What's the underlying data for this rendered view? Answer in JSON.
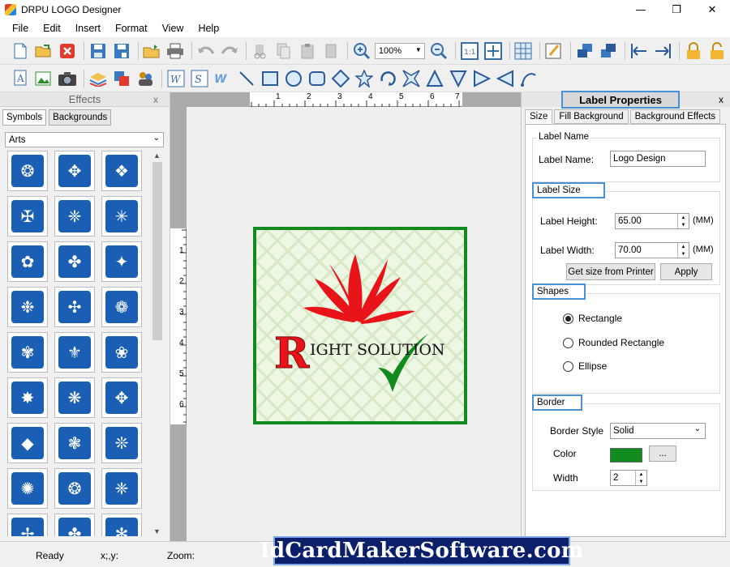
{
  "window": {
    "title": "DRPU LOGO Designer",
    "controls": [
      "—",
      "❐",
      "✕"
    ]
  },
  "menu": [
    "File",
    "Edit",
    "Insert",
    "Format",
    "View",
    "Help"
  ],
  "toolbar": {
    "zoom_value": "100%"
  },
  "effects_panel": {
    "title": "Effects",
    "close": "x",
    "tabs": [
      "Symbols",
      "Backgrounds"
    ],
    "category": "Arts",
    "symbol_glyphs": [
      "❂",
      "✥",
      "❖",
      "✠",
      "❈",
      "✳",
      "✿",
      "✤",
      "✦",
      "❉",
      "✣",
      "❁",
      "✾",
      "⚜",
      "❀",
      "✸",
      "❋",
      "✥",
      "◆",
      "❃",
      "❊",
      "✺",
      "❂",
      "❈",
      "✢",
      "✤",
      "✻"
    ]
  },
  "canvas": {
    "ruler_h": [
      "1",
      "2",
      "3",
      "4",
      "5",
      "6",
      "7"
    ],
    "ruler_v": [
      "1",
      "2",
      "3",
      "4",
      "5",
      "6"
    ],
    "logo": {
      "initial": "R",
      "text": "IGHT SOLUTION",
      "accent_red": "#e8141a",
      "accent_green": "#118a1e"
    }
  },
  "properties": {
    "title": "Label Properties",
    "close": "x",
    "tabs": [
      "Size",
      "Fill Background",
      "Background Effects"
    ],
    "label_name_group": "Label Name",
    "label_name_label": "Label Name:",
    "label_name_value": "Logo Design",
    "label_size_group": "Label Size",
    "height_label": "Label Height:",
    "height_value": "65.00",
    "height_unit": "(MM)",
    "width_label": "Label Width:",
    "width_value": "70.00",
    "width_unit": "(MM)",
    "get_size_button": "Get size from Printer",
    "apply_button": "Apply",
    "shapes_group": "Shapes",
    "shape_options": [
      "Rectangle",
      "Rounded Rectangle",
      "Ellipse"
    ],
    "selected_shape": "Rectangle",
    "border_group": "Border",
    "border_style_label": "Border Style",
    "border_style_value": "Solid",
    "color_label": "Color",
    "color_value": "#118a1e",
    "color_button": "...",
    "border_width_label": "Width",
    "border_width_value": "2"
  },
  "status": {
    "ready": "Ready",
    "coords": "x;,y:",
    "zoom": "Zoom:",
    "banner": "IdCardMakerSoftware.com"
  }
}
